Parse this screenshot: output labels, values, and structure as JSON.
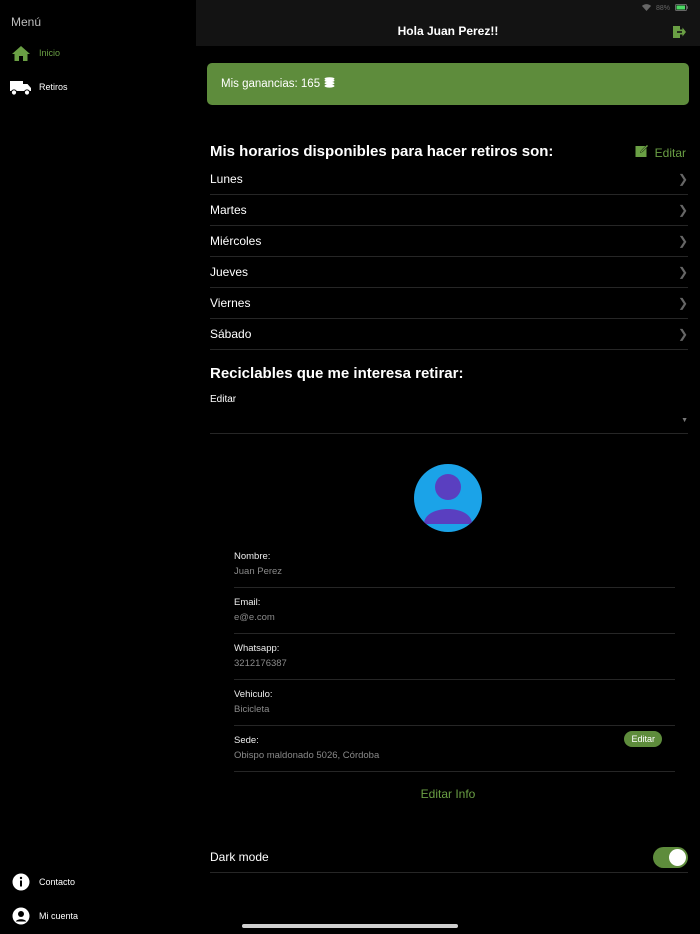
{
  "sidebar": {
    "title": "Menú",
    "items": [
      {
        "label": "Inicio",
        "icon": "home-icon"
      },
      {
        "label": "Retiros",
        "icon": "truck-icon"
      }
    ],
    "bottom_items": [
      {
        "label": "Contacto",
        "icon": "info-icon"
      },
      {
        "label": "Mi cuenta",
        "icon": "account-icon"
      }
    ]
  },
  "header": {
    "title": "Hola Juan Perez!!",
    "battery_text": "88%"
  },
  "earnings": {
    "text": "Mis ganancias: 165"
  },
  "schedule": {
    "heading": "Mis horarios disponibles para hacer retiros son:",
    "edit_label": "Editar",
    "days": [
      "Lunes",
      "Martes",
      "Miércoles",
      "Jueves",
      "Viernes",
      "Sábado"
    ]
  },
  "recyclables": {
    "heading": "Reciclables que me interesa retirar:",
    "field_label": "Editar"
  },
  "profile": {
    "fields": [
      {
        "label": "Nombre:",
        "value": "Juan Perez"
      },
      {
        "label": "Email:",
        "value": "e@e.com"
      },
      {
        "label": "Whatsapp:",
        "value": "3212176387"
      },
      {
        "label": "Vehiculo:",
        "value": "Bicicleta"
      },
      {
        "label": "Sede:",
        "value": "Obispo maldonado 5026, Córdoba"
      }
    ],
    "sede_edit_label": "Editar",
    "edit_info_label": "Editar Info"
  },
  "settings": {
    "dark_mode_label": "Dark mode",
    "dark_mode_on": true
  },
  "colors": {
    "accent": "#5e8c3c",
    "accent_text": "#6a9f44",
    "avatar_bg": "#1ba3e8",
    "avatar_figure": "#5a3fc0"
  }
}
